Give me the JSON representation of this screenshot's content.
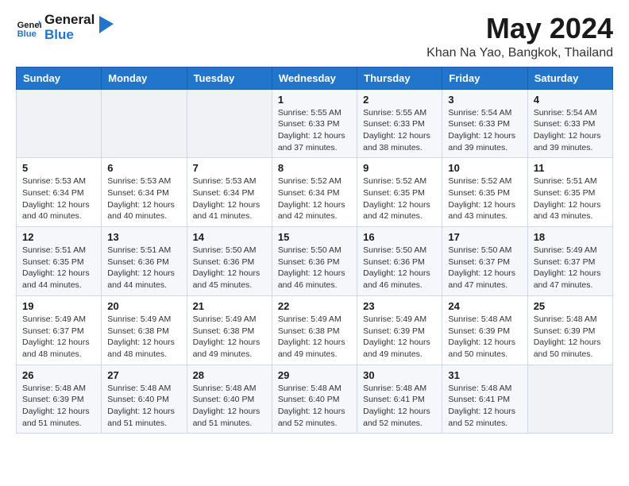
{
  "logo": {
    "line1": "General",
    "line2": "Blue"
  },
  "title": "May 2024",
  "subtitle": "Khan Na Yao, Bangkok, Thailand",
  "days_of_week": [
    "Sunday",
    "Monday",
    "Tuesday",
    "Wednesday",
    "Thursday",
    "Friday",
    "Saturday"
  ],
  "weeks": [
    [
      {
        "day": "",
        "sunrise": "",
        "sunset": "",
        "daylight": ""
      },
      {
        "day": "",
        "sunrise": "",
        "sunset": "",
        "daylight": ""
      },
      {
        "day": "",
        "sunrise": "",
        "sunset": "",
        "daylight": ""
      },
      {
        "day": "1",
        "sunrise": "Sunrise: 5:55 AM",
        "sunset": "Sunset: 6:33 PM",
        "daylight": "Daylight: 12 hours and 37 minutes."
      },
      {
        "day": "2",
        "sunrise": "Sunrise: 5:55 AM",
        "sunset": "Sunset: 6:33 PM",
        "daylight": "Daylight: 12 hours and 38 minutes."
      },
      {
        "day": "3",
        "sunrise": "Sunrise: 5:54 AM",
        "sunset": "Sunset: 6:33 PM",
        "daylight": "Daylight: 12 hours and 39 minutes."
      },
      {
        "day": "4",
        "sunrise": "Sunrise: 5:54 AM",
        "sunset": "Sunset: 6:33 PM",
        "daylight": "Daylight: 12 hours and 39 minutes."
      }
    ],
    [
      {
        "day": "5",
        "sunrise": "Sunrise: 5:53 AM",
        "sunset": "Sunset: 6:34 PM",
        "daylight": "Daylight: 12 hours and 40 minutes."
      },
      {
        "day": "6",
        "sunrise": "Sunrise: 5:53 AM",
        "sunset": "Sunset: 6:34 PM",
        "daylight": "Daylight: 12 hours and 40 minutes."
      },
      {
        "day": "7",
        "sunrise": "Sunrise: 5:53 AM",
        "sunset": "Sunset: 6:34 PM",
        "daylight": "Daylight: 12 hours and 41 minutes."
      },
      {
        "day": "8",
        "sunrise": "Sunrise: 5:52 AM",
        "sunset": "Sunset: 6:34 PM",
        "daylight": "Daylight: 12 hours and 42 minutes."
      },
      {
        "day": "9",
        "sunrise": "Sunrise: 5:52 AM",
        "sunset": "Sunset: 6:35 PM",
        "daylight": "Daylight: 12 hours and 42 minutes."
      },
      {
        "day": "10",
        "sunrise": "Sunrise: 5:52 AM",
        "sunset": "Sunset: 6:35 PM",
        "daylight": "Daylight: 12 hours and 43 minutes."
      },
      {
        "day": "11",
        "sunrise": "Sunrise: 5:51 AM",
        "sunset": "Sunset: 6:35 PM",
        "daylight": "Daylight: 12 hours and 43 minutes."
      }
    ],
    [
      {
        "day": "12",
        "sunrise": "Sunrise: 5:51 AM",
        "sunset": "Sunset: 6:35 PM",
        "daylight": "Daylight: 12 hours and 44 minutes."
      },
      {
        "day": "13",
        "sunrise": "Sunrise: 5:51 AM",
        "sunset": "Sunset: 6:36 PM",
        "daylight": "Daylight: 12 hours and 44 minutes."
      },
      {
        "day": "14",
        "sunrise": "Sunrise: 5:50 AM",
        "sunset": "Sunset: 6:36 PM",
        "daylight": "Daylight: 12 hours and 45 minutes."
      },
      {
        "day": "15",
        "sunrise": "Sunrise: 5:50 AM",
        "sunset": "Sunset: 6:36 PM",
        "daylight": "Daylight: 12 hours and 46 minutes."
      },
      {
        "day": "16",
        "sunrise": "Sunrise: 5:50 AM",
        "sunset": "Sunset: 6:36 PM",
        "daylight": "Daylight: 12 hours and 46 minutes."
      },
      {
        "day": "17",
        "sunrise": "Sunrise: 5:50 AM",
        "sunset": "Sunset: 6:37 PM",
        "daylight": "Daylight: 12 hours and 47 minutes."
      },
      {
        "day": "18",
        "sunrise": "Sunrise: 5:49 AM",
        "sunset": "Sunset: 6:37 PM",
        "daylight": "Daylight: 12 hours and 47 minutes."
      }
    ],
    [
      {
        "day": "19",
        "sunrise": "Sunrise: 5:49 AM",
        "sunset": "Sunset: 6:37 PM",
        "daylight": "Daylight: 12 hours and 48 minutes."
      },
      {
        "day": "20",
        "sunrise": "Sunrise: 5:49 AM",
        "sunset": "Sunset: 6:38 PM",
        "daylight": "Daylight: 12 hours and 48 minutes."
      },
      {
        "day": "21",
        "sunrise": "Sunrise: 5:49 AM",
        "sunset": "Sunset: 6:38 PM",
        "daylight": "Daylight: 12 hours and 49 minutes."
      },
      {
        "day": "22",
        "sunrise": "Sunrise: 5:49 AM",
        "sunset": "Sunset: 6:38 PM",
        "daylight": "Daylight: 12 hours and 49 minutes."
      },
      {
        "day": "23",
        "sunrise": "Sunrise: 5:49 AM",
        "sunset": "Sunset: 6:39 PM",
        "daylight": "Daylight: 12 hours and 49 minutes."
      },
      {
        "day": "24",
        "sunrise": "Sunrise: 5:48 AM",
        "sunset": "Sunset: 6:39 PM",
        "daylight": "Daylight: 12 hours and 50 minutes."
      },
      {
        "day": "25",
        "sunrise": "Sunrise: 5:48 AM",
        "sunset": "Sunset: 6:39 PM",
        "daylight": "Daylight: 12 hours and 50 minutes."
      }
    ],
    [
      {
        "day": "26",
        "sunrise": "Sunrise: 5:48 AM",
        "sunset": "Sunset: 6:39 PM",
        "daylight": "Daylight: 12 hours and 51 minutes."
      },
      {
        "day": "27",
        "sunrise": "Sunrise: 5:48 AM",
        "sunset": "Sunset: 6:40 PM",
        "daylight": "Daylight: 12 hours and 51 minutes."
      },
      {
        "day": "28",
        "sunrise": "Sunrise: 5:48 AM",
        "sunset": "Sunset: 6:40 PM",
        "daylight": "Daylight: 12 hours and 51 minutes."
      },
      {
        "day": "29",
        "sunrise": "Sunrise: 5:48 AM",
        "sunset": "Sunset: 6:40 PM",
        "daylight": "Daylight: 12 hours and 52 minutes."
      },
      {
        "day": "30",
        "sunrise": "Sunrise: 5:48 AM",
        "sunset": "Sunset: 6:41 PM",
        "daylight": "Daylight: 12 hours and 52 minutes."
      },
      {
        "day": "31",
        "sunrise": "Sunrise: 5:48 AM",
        "sunset": "Sunset: 6:41 PM",
        "daylight": "Daylight: 12 hours and 52 minutes."
      },
      {
        "day": "",
        "sunrise": "",
        "sunset": "",
        "daylight": ""
      }
    ]
  ],
  "colors": {
    "header_bg": "#2176cc",
    "header_text": "#ffffff",
    "odd_row_bg": "#f5f7fa",
    "even_row_bg": "#ffffff",
    "empty_cell_bg": "#f0f2f5"
  }
}
